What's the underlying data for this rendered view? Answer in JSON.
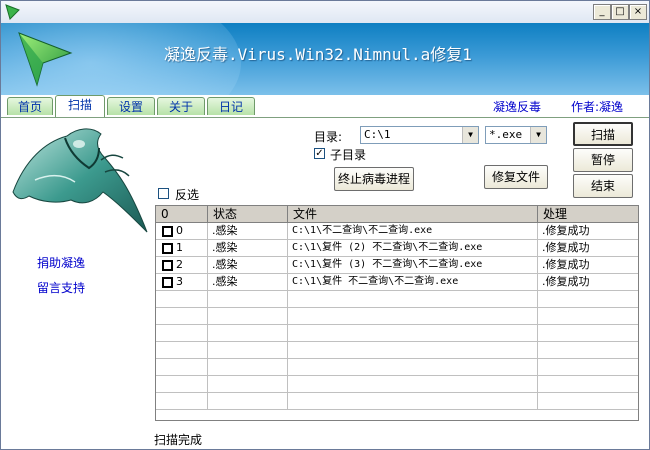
{
  "window": {
    "controls": {
      "minimize": "_",
      "maximize": "□",
      "close": "×"
    }
  },
  "banner": {
    "title": "凝逸反毒.Virus.Win32.Nimnul.a修复1"
  },
  "tabs": [
    {
      "label": "首页"
    },
    {
      "label": "扫描"
    },
    {
      "label": "设置"
    },
    {
      "label": "关于"
    },
    {
      "label": "日记"
    }
  ],
  "header_links": {
    "brand": "凝逸反毒",
    "author": "作者:凝逸"
  },
  "sidebar": {
    "links": [
      {
        "label": "捐助凝逸"
      },
      {
        "label": "留言支持"
      }
    ]
  },
  "scan": {
    "dir_label": "目录:",
    "dir_value": "C:\\1",
    "ext_value": "*.exe",
    "subdir_label": "子目录",
    "subdir_checked": "✓",
    "invert_label": "反选",
    "kill_button": "终止病毒进程",
    "repair_button": "修复文件",
    "scan_button": "扫描",
    "pause_button": "暂停",
    "end_button": "结束"
  },
  "table": {
    "columns": [
      "0",
      "状态",
      "文件",
      "处理"
    ],
    "rows": [
      {
        "id": "0",
        "status": ".感染",
        "file": "C:\\1\\不二查询\\不二查询.exe",
        "action": ".修复成功"
      },
      {
        "id": "1",
        "status": ".感染",
        "file": "C:\\1\\复件 (2) 不二查询\\不二查询.exe",
        "action": ".修复成功"
      },
      {
        "id": "2",
        "status": ".感染",
        "file": "C:\\1\\复件 (3) 不二查询\\不二查询.exe",
        "action": ".修复成功"
      },
      {
        "id": "3",
        "status": ".感染",
        "file": "C:\\1\\复件 不二查询\\不二查询.exe",
        "action": ".修复成功"
      }
    ]
  },
  "status_bar": {
    "text": "扫描完成"
  },
  "colors": {
    "banner": "#3b9ad6",
    "tab": "#b7e2a8",
    "link": "#0000cc"
  }
}
